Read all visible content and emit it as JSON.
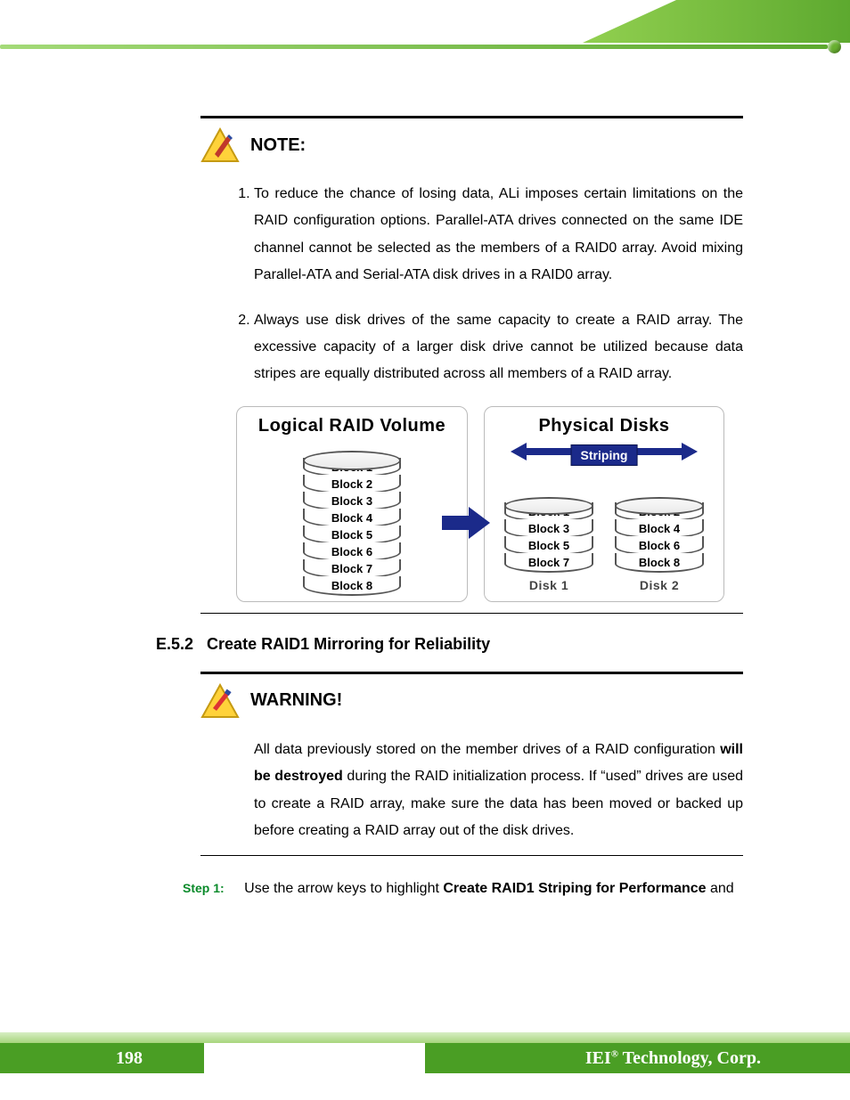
{
  "note": {
    "label": "NOTE:",
    "items": [
      "To reduce the chance of losing data, ALi imposes certain limitations on the RAID configuration options. Parallel-ATA drives connected on the same IDE channel cannot be selected as the members of a RAID0 array. Avoid mixing Parallel-ATA and Serial-ATA disk drives in a RAID0 array.",
      "Always use disk drives of the same capacity to create a RAID array. The excessive capacity of a larger disk drive cannot be utilized because data stripes are equally distributed across all members of a RAID array."
    ]
  },
  "diagram": {
    "left_title": "Logical RAID Volume",
    "right_title": "Physical Disks",
    "logical_blocks": [
      "Block 1",
      "Block 2",
      "Block 3",
      "Block 4",
      "Block 5",
      "Block 6",
      "Block 7",
      "Block 8"
    ],
    "striping_label": "Striping",
    "disk1": {
      "label": "Disk 1",
      "blocks": [
        "Block 1",
        "Block 3",
        "Block 5",
        "Block 7"
      ]
    },
    "disk2": {
      "label": "Disk 2",
      "blocks": [
        "Block 2",
        "Block 4",
        "Block 6",
        "Block 8"
      ]
    }
  },
  "section": {
    "number": "E.5.2",
    "title": "Create RAID1 Mirroring for Reliability"
  },
  "warning": {
    "label": "WARNING!",
    "text_pre": "All data previously stored on the member drives of a RAID configuration ",
    "text_bold": "will be destroyed",
    "text_post": " during the RAID initialization process. If “used” drives are used to create a RAID array, make sure the data has been moved or backed up before creating a RAID array out of the disk drives."
  },
  "step": {
    "label": "Step 1:",
    "text_pre": "Use the arrow keys to highlight ",
    "text_bold": "Create RAID1 Striping for Performance",
    "text_post": " and"
  },
  "footer": {
    "page": "198",
    "brand_pre": "IEI",
    "brand_sup": "®",
    "brand_post": " Technology, Corp."
  }
}
